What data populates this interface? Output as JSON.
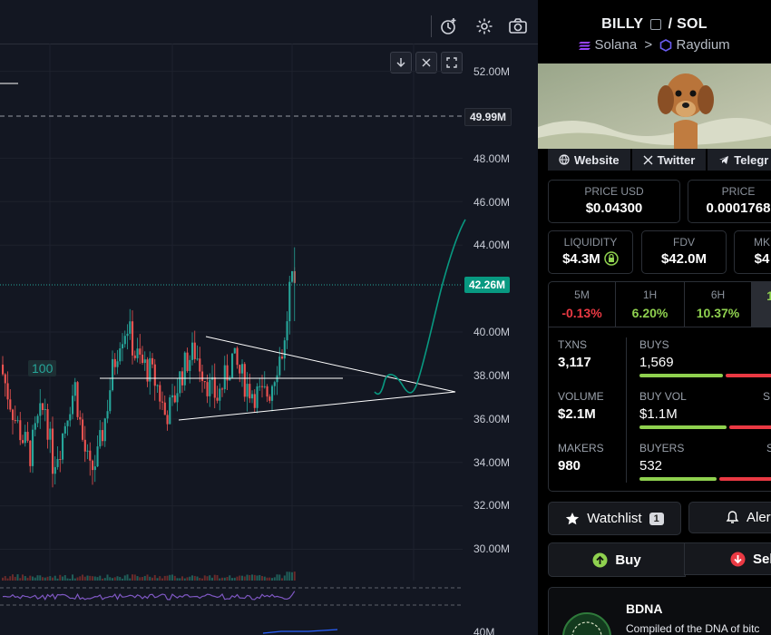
{
  "chart": {
    "y_axis_labels": [
      "52.00M",
      "48.00M",
      "46.00M",
      "44.00M",
      "40.00M",
      "38.00M",
      "36.00M",
      "34.00M",
      "32.00M",
      "30.00M",
      "40M"
    ],
    "marker_label": "49.99M",
    "current_label": "42.26M",
    "line_label": "100",
    "colors": {
      "up": "#26a69a",
      "down": "#ef5350",
      "projection": "#089981",
      "triangle": "#ffffff"
    }
  },
  "chart_data": {
    "type": "candlestick",
    "title": "",
    "ylabel": "",
    "ylim": [
      29,
      53
    ],
    "horizontal_levels": [
      49.99,
      38.0
    ],
    "last_value": 42.26,
    "annotations": [
      "100"
    ],
    "series": [
      {
        "kind": "market_cap_candles_estimated",
        "values": [
          38.5,
          37.2,
          36.0,
          35.1,
          34.4,
          35.8,
          36.6,
          34.0,
          34.8,
          36.4,
          37.5,
          35.0,
          33.5,
          34.2,
          36.0,
          38.2,
          39.8,
          40.3,
          39.0,
          38.5,
          38.2,
          37.5,
          36.2,
          36.6,
          37.9,
          38.7,
          39.1,
          38.3,
          37.4,
          37.0,
          37.8,
          38.8,
          38.1,
          37.5,
          37.2,
          37.0,
          37.3,
          38.6,
          39.4,
          42.0,
          42.26
        ]
      }
    ]
  },
  "toolbar": {
    "icons": [
      "alert-icon",
      "gear-icon",
      "camera-icon"
    ]
  },
  "mini_buttons": {
    "icons": [
      "arrow-down-icon",
      "collapse-icon",
      "fullscreen-icon"
    ]
  },
  "pair": {
    "base": "BILLY",
    "sep": "/",
    "quote": "SOL",
    "chain": "Solana",
    "dex": "Raydium",
    "separator": ">"
  },
  "links": [
    "Website",
    "Twitter",
    "Telegr"
  ],
  "prices": {
    "usd": {
      "label": "PRICE USD",
      "value": "$0.04300"
    },
    "native": {
      "label": "PRICE",
      "value": "0.0001768"
    }
  },
  "metrics": {
    "liquidity": {
      "label": "LIQUIDITY",
      "value": "$4.3M"
    },
    "fdv": {
      "label": "FDV",
      "value": "$42.0M"
    },
    "mkt": {
      "label": "MK",
      "value": "$4"
    }
  },
  "changes": [
    {
      "label": "5M",
      "value": "-0.13%",
      "color": "#ea3943"
    },
    {
      "label": "1H",
      "value": "6.20%",
      "color": "#8fd14f"
    },
    {
      "label": "6H",
      "value": "10.37%",
      "color": "#8fd14f"
    },
    {
      "label": "",
      "value": "1",
      "color": "#8fd14f"
    }
  ],
  "stats": {
    "txns": {
      "label": "TXNS",
      "value": "3,117"
    },
    "buys": {
      "label": "BUYS",
      "value": "1,569"
    },
    "volume": {
      "label": "VOLUME",
      "value": "$2.1M"
    },
    "buy_vol": {
      "label": "BUY VOL",
      "value": "$1.1M"
    },
    "sell_vol_label": "S",
    "makers": {
      "label": "MAKERS",
      "value": "980"
    },
    "buyers": {
      "label": "BUYERS",
      "value": "532"
    },
    "sellers_label": "S",
    "buy_share": 0.52,
    "buy_vol_share": 0.52,
    "buyers_share": 0.53
  },
  "actions": {
    "watchlist": "Watchlist",
    "watchlist_count": "1",
    "alerts": "Aler",
    "buy": "Buy",
    "sell": "Sel"
  },
  "token_card": {
    "name": "BDNA",
    "description": "Compiled of the DNA of bitc"
  }
}
